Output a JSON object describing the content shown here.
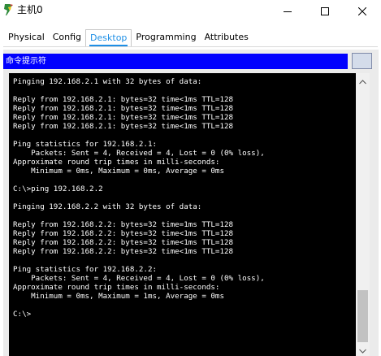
{
  "window": {
    "title": "主机0",
    "icon": "packet-tracer-pc-icon",
    "controls": {
      "minimize_icon": "minimize-icon",
      "maximize_icon": "maximize-icon",
      "close_icon": "close-icon"
    }
  },
  "tabs": [
    {
      "label": "Physical",
      "active": false
    },
    {
      "label": "Config",
      "active": false
    },
    {
      "label": "Desktop",
      "active": true
    },
    {
      "label": "Programming",
      "active": false
    },
    {
      "label": "Attributes",
      "active": false
    }
  ],
  "panel": {
    "title": "命令提示符",
    "header_color": "#0000fe"
  },
  "console": {
    "background": "#000000",
    "foreground": "#ffffff",
    "lines": [
      "Pinging 192.168.2.1 with 32 bytes of data:",
      "",
      "Reply from 192.168.2.1: bytes=32 time<1ms TTL=128",
      "Reply from 192.168.2.1: bytes=32 time<1ms TTL=128",
      "Reply from 192.168.2.1: bytes=32 time<1ms TTL=128",
      "Reply from 192.168.2.1: bytes=32 time<1ms TTL=128",
      "",
      "Ping statistics for 192.168.2.1:",
      "    Packets: Sent = 4, Received = 4, Lost = 0 (0% loss),",
      "Approximate round trip times in milli-seconds:",
      "    Minimum = 0ms, Maximum = 0ms, Average = 0ms",
      "",
      "C:\\>ping 192.168.2.2",
      "",
      "Pinging 192.168.2.2 with 32 bytes of data:",
      "",
      "Reply from 192.168.2.2: bytes=32 time=1ms TTL=128",
      "Reply from 192.168.2.2: bytes=32 time<1ms TTL=128",
      "Reply from 192.168.2.2: bytes=32 time<1ms TTL=128",
      "Reply from 192.168.2.2: bytes=32 time<1ms TTL=128",
      "",
      "Ping statistics for 192.168.2.2:",
      "    Packets: Sent = 4, Received = 4, Lost = 0 (0% loss),",
      "Approximate round trip times in milli-seconds:",
      "    Minimum = 0ms, Maximum = 1ms, Average = 0ms",
      "",
      "C:\\>"
    ]
  },
  "scrollbar": {
    "up_icon": "scroll-up-arrow-icon",
    "down_icon": "scroll-down-arrow-icon"
  }
}
